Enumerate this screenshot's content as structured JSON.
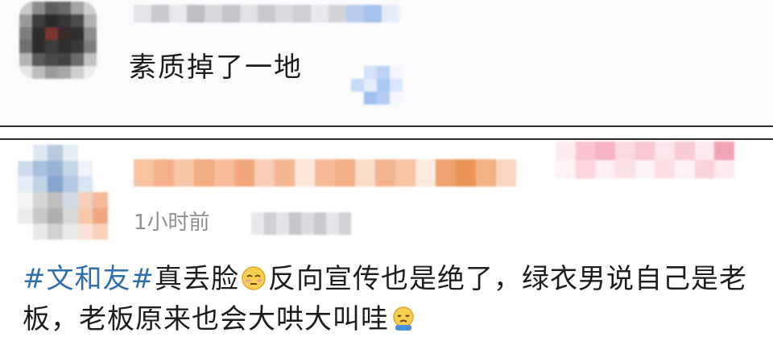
{
  "comments": [
    {
      "text": "素质掉了一地"
    },
    {
      "time": "1小时前",
      "hashtag1": "#文和友#",
      "hashtag2": "真丢脸",
      "emoji1": "shy-emoji",
      "text_part1": "反向宣传也是绝了，绿衣男说自己是老板，老板原来也会大哄大叫哇",
      "emoji2": "crying-emoji"
    }
  ],
  "colors": {
    "hashtag": "#2f6fb0",
    "text": "#1d1d1f",
    "timestamp": "#8e8e93",
    "separator": "#2b2b2b"
  }
}
